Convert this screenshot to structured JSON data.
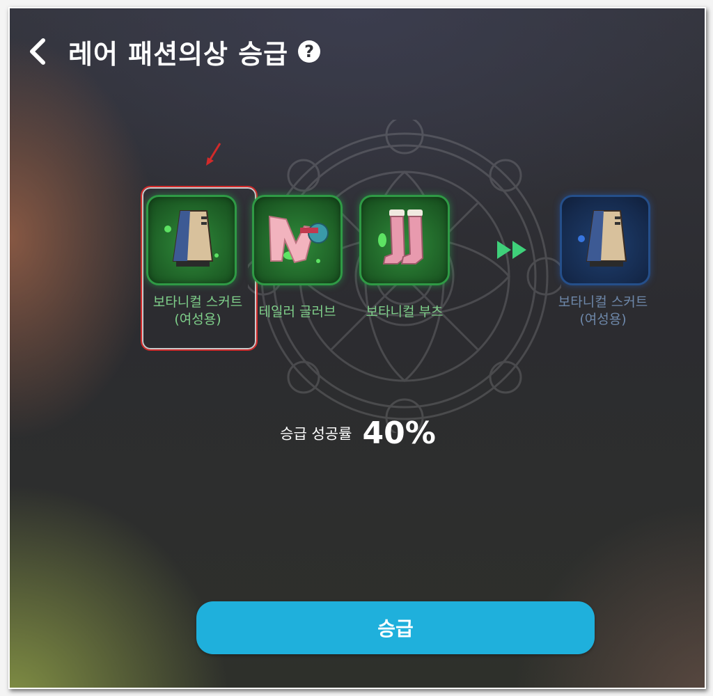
{
  "header": {
    "title": "레어 패션의상 승급"
  },
  "materials": [
    {
      "name_line1": "보타니컬 스커트",
      "name_line2": "(여성용)",
      "icon": "skirt-icon"
    },
    {
      "name_line1": "테일러 글러브",
      "name_line2": "",
      "icon": "glove-icon"
    },
    {
      "name_line1": "보타니컬 부츠",
      "name_line2": "",
      "icon": "boots-icon"
    }
  ],
  "result": {
    "name_line1": "보타니컬 스커트",
    "name_line2": "(여성용)",
    "icon": "skirt-icon"
  },
  "success": {
    "label": "승급 성공률",
    "value": "40%"
  },
  "upgrade_button": {
    "label": "승급"
  },
  "colors": {
    "accent": "#1fb0dc",
    "material_frame": "#2f9a45",
    "result_frame": "#254f8a",
    "highlight": "#d22a2a"
  }
}
